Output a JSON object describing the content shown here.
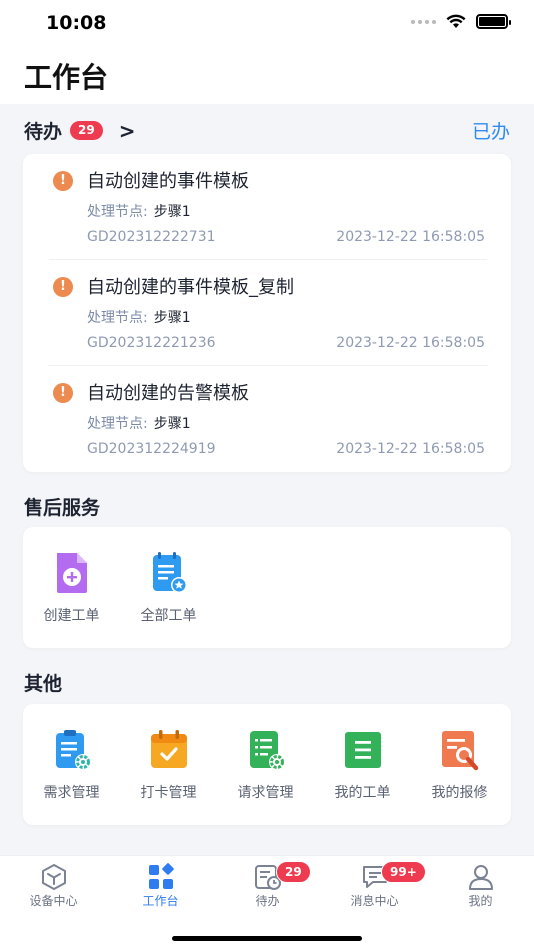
{
  "status": {
    "time": "10:08"
  },
  "header": {
    "title": "工作台"
  },
  "todo": {
    "title": "待办",
    "count": "29",
    "arrow": ">",
    "done_label": "已办",
    "node_label": "处理节点:",
    "items": [
      {
        "title": "自动创建的事件模板",
        "node": "步骤1",
        "code": "GD202312222731",
        "time": "2023-12-22 16:58:05"
      },
      {
        "title": "自动创建的事件模板_复制",
        "node": "步骤1",
        "code": "GD202312221236",
        "time": "2023-12-22 16:58:05"
      },
      {
        "title": "自动创建的告警模板",
        "node": "步骤1",
        "code": "GD202312224919",
        "time": "2023-12-22 16:58:05"
      }
    ]
  },
  "after_sales": {
    "title": "售后服务",
    "items": [
      {
        "label": "创建工单",
        "icon": "add-document-icon"
      },
      {
        "label": "全部工单",
        "icon": "starred-list-icon"
      }
    ]
  },
  "other": {
    "title": "其他",
    "items": [
      {
        "label": "需求管理",
        "icon": "clipboard-gear-icon"
      },
      {
        "label": "打卡管理",
        "icon": "calendar-check-icon"
      },
      {
        "label": "请求管理",
        "icon": "list-gear-icon"
      },
      {
        "label": "我的工单",
        "icon": "list-icon"
      },
      {
        "label": "我的报修",
        "icon": "wrench-document-icon"
      }
    ]
  },
  "tabbar": {
    "items": [
      {
        "label": "设备中心",
        "icon": "cube-icon"
      },
      {
        "label": "工作台",
        "icon": "grid-icon",
        "active": true
      },
      {
        "label": "待办",
        "icon": "clock-document-icon",
        "badge": "29"
      },
      {
        "label": "消息中心",
        "icon": "message-icon",
        "badge": "99+"
      },
      {
        "label": "我的",
        "icon": "user-icon"
      }
    ]
  },
  "colors": {
    "accent": "#2f7bf0",
    "badge": "#ef3b4f",
    "warning": "#ec8a4f"
  }
}
